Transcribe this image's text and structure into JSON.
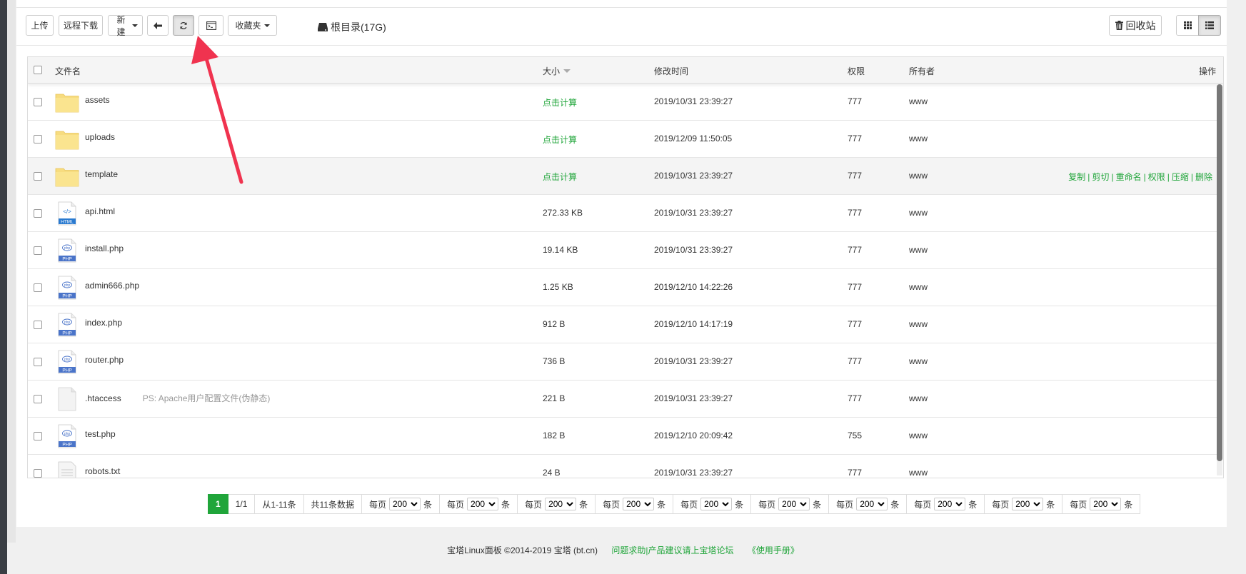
{
  "toolbar": {
    "upload": "上传",
    "remote_download": "远程下载",
    "new": "新建",
    "back_icon": "arrow-left-icon",
    "refresh_icon": "refresh-icon",
    "terminal_icon": "terminal-icon",
    "favorites": "收藏夹",
    "path": "根目录(17G)",
    "recycle": "回收站",
    "grid_view_icon": "grid-icon",
    "list_view_icon": "list-icon"
  },
  "table": {
    "headers": {
      "name": "文件名",
      "size": "大小",
      "mtime": "修改时间",
      "perm": "权限",
      "owner": "所有者",
      "ops": "操作"
    },
    "rows": [
      {
        "name": "assets",
        "type": "folder",
        "size": "点击计算",
        "mtime": "2019/10/31 23:39:27",
        "perm": "777",
        "owner": "www",
        "note": ""
      },
      {
        "name": "uploads",
        "type": "folder",
        "size": "点击计算",
        "mtime": "2019/12/09 11:50:05",
        "perm": "777",
        "owner": "www",
        "note": ""
      },
      {
        "name": "template",
        "type": "folder",
        "size": "点击计算",
        "mtime": "2019/10/31 23:39:27",
        "perm": "777",
        "owner": "www",
        "note": ""
      },
      {
        "name": "api.html",
        "type": "html",
        "size": "272.33 KB",
        "mtime": "2019/10/31 23:39:27",
        "perm": "777",
        "owner": "www",
        "note": ""
      },
      {
        "name": "install.php",
        "type": "php",
        "size": "19.14 KB",
        "mtime": "2019/10/31 23:39:27",
        "perm": "777",
        "owner": "www",
        "note": ""
      },
      {
        "name": "admin666.php",
        "type": "php",
        "size": "1.25 KB",
        "mtime": "2019/12/10 14:22:26",
        "perm": "777",
        "owner": "www",
        "note": ""
      },
      {
        "name": "index.php",
        "type": "php",
        "size": "912 B",
        "mtime": "2019/12/10 14:17:19",
        "perm": "777",
        "owner": "www",
        "note": ""
      },
      {
        "name": "router.php",
        "type": "php",
        "size": "736 B",
        "mtime": "2019/10/31 23:39:27",
        "perm": "777",
        "owner": "www",
        "note": ""
      },
      {
        "name": ".htaccess",
        "type": "blank",
        "size": "221 B",
        "mtime": "2019/10/31 23:39:27",
        "perm": "777",
        "owner": "www",
        "note": "PS: Apache用户配置文件(伪静态)"
      },
      {
        "name": "test.php",
        "type": "php",
        "size": "182 B",
        "mtime": "2019/12/10 20:09:42",
        "perm": "755",
        "owner": "www",
        "note": ""
      },
      {
        "name": "robots.txt",
        "type": "txt",
        "size": "24 B",
        "mtime": "2019/10/31 23:39:27",
        "perm": "777",
        "owner": "www",
        "note": ""
      }
    ],
    "row_ops": [
      "复制",
      "剪切",
      "重命名",
      "权限",
      "压缩",
      "删除"
    ]
  },
  "icons": {
    "html_label": "HTML",
    "php_label": "PHP",
    "html_glyph": "</>",
    "php_glyph": "php"
  },
  "pager": {
    "current": "1",
    "pages": "1/1",
    "range": "从1-11条",
    "total": "共11条数据",
    "per_page_prefix": "每页",
    "per_page_value": "200",
    "per_page_suffix": "条",
    "per_page_groups": 10
  },
  "footer": {
    "copyright": "宝塔Linux面板 ©2014-2019 宝塔 (bt.cn)",
    "forum": "问题求助|产品建议请上宝塔论坛",
    "manual": "《使用手册》"
  },
  "colors": {
    "accent": "#20a53a",
    "annotation_arrow": "#f0334f",
    "folder": "#f7dc7f"
  }
}
